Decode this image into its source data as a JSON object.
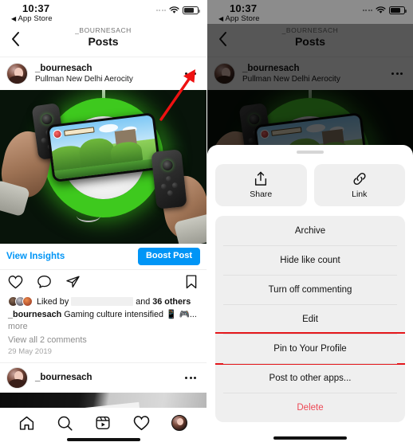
{
  "status_bar": {
    "time": "10:37",
    "back_app": "App Store",
    "back_glyph": "◀",
    "signal_icon": "signal-dots-icon",
    "wifi_icon": "wifi-icon",
    "battery_icon": "battery-icon"
  },
  "nav": {
    "back_icon": "chevron-left-icon",
    "subtitle": "_BOURNESACH",
    "title": "Posts"
  },
  "post": {
    "username": "_bournesach",
    "location": "Pullman New Delhi Aerocity",
    "more_icon": "more-options-icon",
    "avatar_icon": "user-avatar",
    "media_alt": "hands holding phone with game controller grips in front of green ring light",
    "insights_label": "View Insights",
    "boost_label": "Boost Post",
    "like_icon": "heart-icon",
    "comment_icon": "comment-bubble-icon",
    "share_icon": "send-paper-plane-icon",
    "save_icon": "bookmark-icon",
    "liked_by_prefix": "Liked by",
    "liked_by_redacted": "",
    "liked_by_suffix_and": "and",
    "liked_by_count": "36 others",
    "caption_user": "_bournesach",
    "caption_text": "Gaming culture intensified 📱 🎮...",
    "more_label": "more",
    "comments_label": "View all 2 comments",
    "date": "29 May 2019"
  },
  "post2": {
    "username": "_bournesach",
    "more_icon": "more-options-icon",
    "avatar_icon": "user-avatar"
  },
  "tabbar": {
    "home_icon": "home-icon",
    "search_icon": "search-icon",
    "reels_icon": "reels-icon",
    "activity_icon": "heart-icon",
    "profile_icon": "profile-avatar-icon"
  },
  "annotation": {
    "arrow_icon": "red-arrow-pointing-to-more-options",
    "arrow_color": "#ee1111",
    "highlight_color": "#e4171b"
  },
  "sheet": {
    "grabber_icon": "drag-handle",
    "quick_actions": [
      {
        "label": "Share",
        "icon": "share-upload-icon"
      },
      {
        "label": "Link",
        "icon": "link-chain-icon"
      }
    ],
    "menu_items": [
      {
        "label": "Archive",
        "style": "normal",
        "highlighted": false
      },
      {
        "label": "Hide like count",
        "style": "normal",
        "highlighted": false
      },
      {
        "label": "Turn off commenting",
        "style": "normal",
        "highlighted": false
      },
      {
        "label": "Edit",
        "style": "normal",
        "highlighted": false
      },
      {
        "label": "Pin to Your Profile",
        "style": "normal",
        "highlighted": true
      },
      {
        "label": "Post to other apps...",
        "style": "normal",
        "highlighted": false
      },
      {
        "label": "Delete",
        "style": "danger",
        "highlighted": false
      }
    ]
  },
  "colors": {
    "accent_blue": "#0095F6",
    "danger_red": "#ED4956",
    "annotation_red": "#E4171B",
    "card_gray": "#EFEFEF"
  }
}
